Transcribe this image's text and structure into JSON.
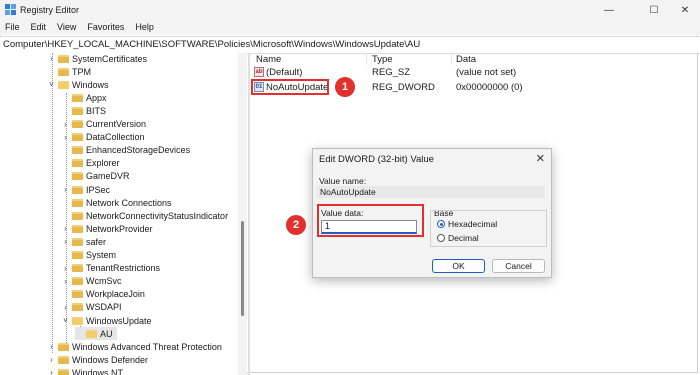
{
  "window": {
    "title": "Registry Editor",
    "minimize_icon": "minimize-icon",
    "maximize_icon": "maximize-icon",
    "close_icon": "close-icon"
  },
  "menu": [
    "File",
    "Edit",
    "View",
    "Favorites",
    "Help"
  ],
  "address": "Computer\\HKEY_LOCAL_MACHINE\\SOFTWARE\\Policies\\Microsoft\\Windows\\WindowsUpdate\\AU",
  "tree": [
    {
      "label": "SystemCertificates",
      "level": 1,
      "chevron": ">"
    },
    {
      "label": "TPM",
      "level": 1,
      "chevron": ""
    },
    {
      "label": "Windows",
      "level": 1,
      "chevron": "v"
    },
    {
      "label": "Appx",
      "level": 2,
      "chevron": ""
    },
    {
      "label": "BITS",
      "level": 2,
      "chevron": ""
    },
    {
      "label": "CurrentVersion",
      "level": 2,
      "chevron": ">"
    },
    {
      "label": "DataCollection",
      "level": 2,
      "chevron": ">"
    },
    {
      "label": "EnhancedStorageDevices",
      "level": 2,
      "chevron": ""
    },
    {
      "label": "Explorer",
      "level": 2,
      "chevron": ""
    },
    {
      "label": "GameDVR",
      "level": 2,
      "chevron": ""
    },
    {
      "label": "IPSec",
      "level": 2,
      "chevron": ">"
    },
    {
      "label": "Network Connections",
      "level": 2,
      "chevron": ""
    },
    {
      "label": "NetworkConnectivityStatusIndicator",
      "level": 2,
      "chevron": ""
    },
    {
      "label": "NetworkProvider",
      "level": 2,
      "chevron": ">"
    },
    {
      "label": "safer",
      "level": 2,
      "chevron": ">"
    },
    {
      "label": "System",
      "level": 2,
      "chevron": ""
    },
    {
      "label": "TenantRestrictions",
      "level": 2,
      "chevron": ">"
    },
    {
      "label": "WcmSvc",
      "level": 2,
      "chevron": ">"
    },
    {
      "label": "WorkplaceJoin",
      "level": 2,
      "chevron": ""
    },
    {
      "label": "WSDAPI",
      "level": 2,
      "chevron": ">"
    },
    {
      "label": "WindowsUpdate",
      "level": 2,
      "chevron": "v"
    },
    {
      "label": "AU",
      "level": 3,
      "chevron": "",
      "selected": true
    },
    {
      "label": "Windows Advanced Threat Protection",
      "level": 1,
      "chevron": ">"
    },
    {
      "label": "Windows Defender",
      "level": 1,
      "chevron": ">"
    },
    {
      "label": "Windows NT",
      "level": 1,
      "chevron": ">"
    }
  ],
  "list": {
    "headers": {
      "name": "Name",
      "type": "Type",
      "data": "Data"
    },
    "rows": [
      {
        "name": "(Default)",
        "type": "REG_SZ",
        "data": "(value not set)",
        "icon": "ab"
      },
      {
        "name": "NoAutoUpdate",
        "type": "REG_DWORD",
        "data": "0x00000000 (0)",
        "icon": "dword"
      }
    ]
  },
  "badges": [
    "1",
    "2"
  ],
  "dialog": {
    "title": "Edit DWORD (32-bit) Value",
    "value_name_label": "Value name:",
    "value_name": "NoAutoUpdate",
    "value_data_label": "Value data:",
    "value_data": "1",
    "base_label": "Base",
    "hex_label": "Hexadecimal",
    "dec_label": "Decimal",
    "ok": "OK",
    "cancel": "Cancel"
  },
  "colors": {
    "accent": "#1f5fbf",
    "callout": "#e1302e",
    "folder": "#e8b84a"
  }
}
